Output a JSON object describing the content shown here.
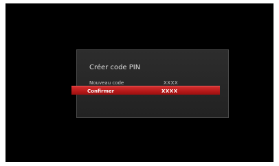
{
  "dialog": {
    "title": "Créer code PIN",
    "fields": [
      {
        "label": "Nouveau code",
        "value": "XXXX"
      },
      {
        "label": "Confirmer",
        "value": "XXXX",
        "selected": true
      }
    ]
  },
  "colors": {
    "background": "#000000",
    "dialog": "#2a2a2a",
    "highlight": "#c62222"
  }
}
